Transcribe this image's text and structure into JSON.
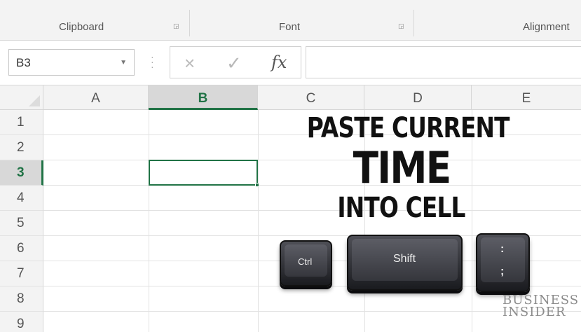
{
  "ribbon": {
    "groups": [
      "Clipboard",
      "Font",
      "Alignment"
    ]
  },
  "formula_bar": {
    "name_box": "B3",
    "cancel_icon": "×",
    "enter_icon": "✓",
    "function_icon": "fx",
    "formula_value": ""
  },
  "grid": {
    "columns": [
      "A",
      "B",
      "C",
      "D",
      "E"
    ],
    "rows": [
      "1",
      "2",
      "3",
      "4",
      "5",
      "6",
      "7",
      "8",
      "9"
    ],
    "selected_column": "B",
    "selected_row": "3",
    "accent_color": "#217346"
  },
  "overlay": {
    "line1": "PASTE CURRENT",
    "line2": "TIME",
    "line3": "INTO CELL"
  },
  "keys": {
    "ctrl": "Ctrl",
    "shift": "Shift",
    "semicolon_top": ":",
    "semicolon_bottom": ";"
  },
  "watermark": {
    "line1": "BUSINESS",
    "line2": "INSIDER"
  }
}
